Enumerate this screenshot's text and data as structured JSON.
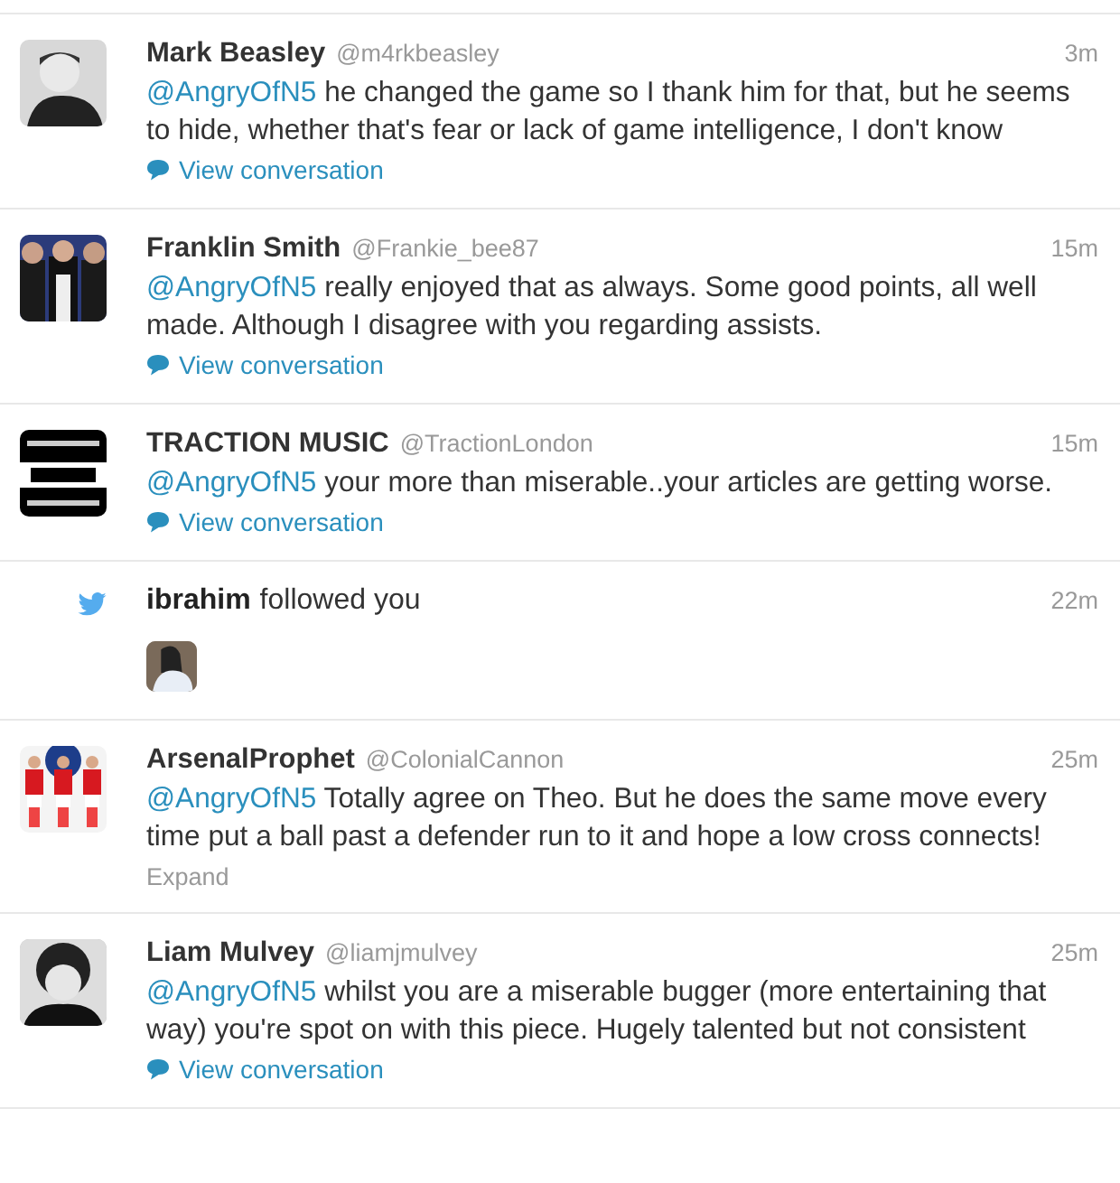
{
  "items": [
    {
      "kind": "tweet",
      "name": "Mark Beasley",
      "handle": "@m4rkbeasley",
      "time": "3m",
      "mention": "@AngryOfN5",
      "text": " he changed the game so I thank him for that, but he seems to hide, whether that's fear or lack of game intelligence, I don't know",
      "footer": {
        "kind": "conversation",
        "label": "View conversation"
      }
    },
    {
      "kind": "tweet",
      "name": "Franklin Smith",
      "handle": "@Frankie_bee87",
      "time": "15m",
      "mention": "@AngryOfN5",
      "text": " really enjoyed that as always. Some good points, all well made. Although I disagree with you regarding assists.",
      "footer": {
        "kind": "conversation",
        "label": "View conversation"
      }
    },
    {
      "kind": "tweet",
      "name": "TRACTION MUSIC",
      "handle": "@TractionLondon",
      "time": "15m",
      "mention": "@AngryOfN5",
      "text": " your more than miserable..your articles are getting worse.",
      "footer": {
        "kind": "conversation",
        "label": "View conversation"
      }
    },
    {
      "kind": "follow",
      "name": "ibrahim",
      "action": "followed you",
      "time": "22m"
    },
    {
      "kind": "tweet",
      "name": "ArsenalProphet",
      "handle": "@ColonialCannon",
      "time": "25m",
      "mention": "@AngryOfN5",
      "text": " Totally agree on Theo. But he does the same move every time put a ball past a defender run to it and hope a low cross connects!",
      "footer": {
        "kind": "expand",
        "label": "Expand"
      }
    },
    {
      "kind": "tweet",
      "name": "Liam Mulvey",
      "handle": "@liamjmulvey",
      "time": "25m",
      "mention": "@AngryOfN5",
      "text": " whilst you are a miserable bugger (more entertaining that way) you're spot on with this piece. Hugely talented but not consistent",
      "footer": {
        "kind": "conversation",
        "label": "View conversation"
      }
    }
  ]
}
